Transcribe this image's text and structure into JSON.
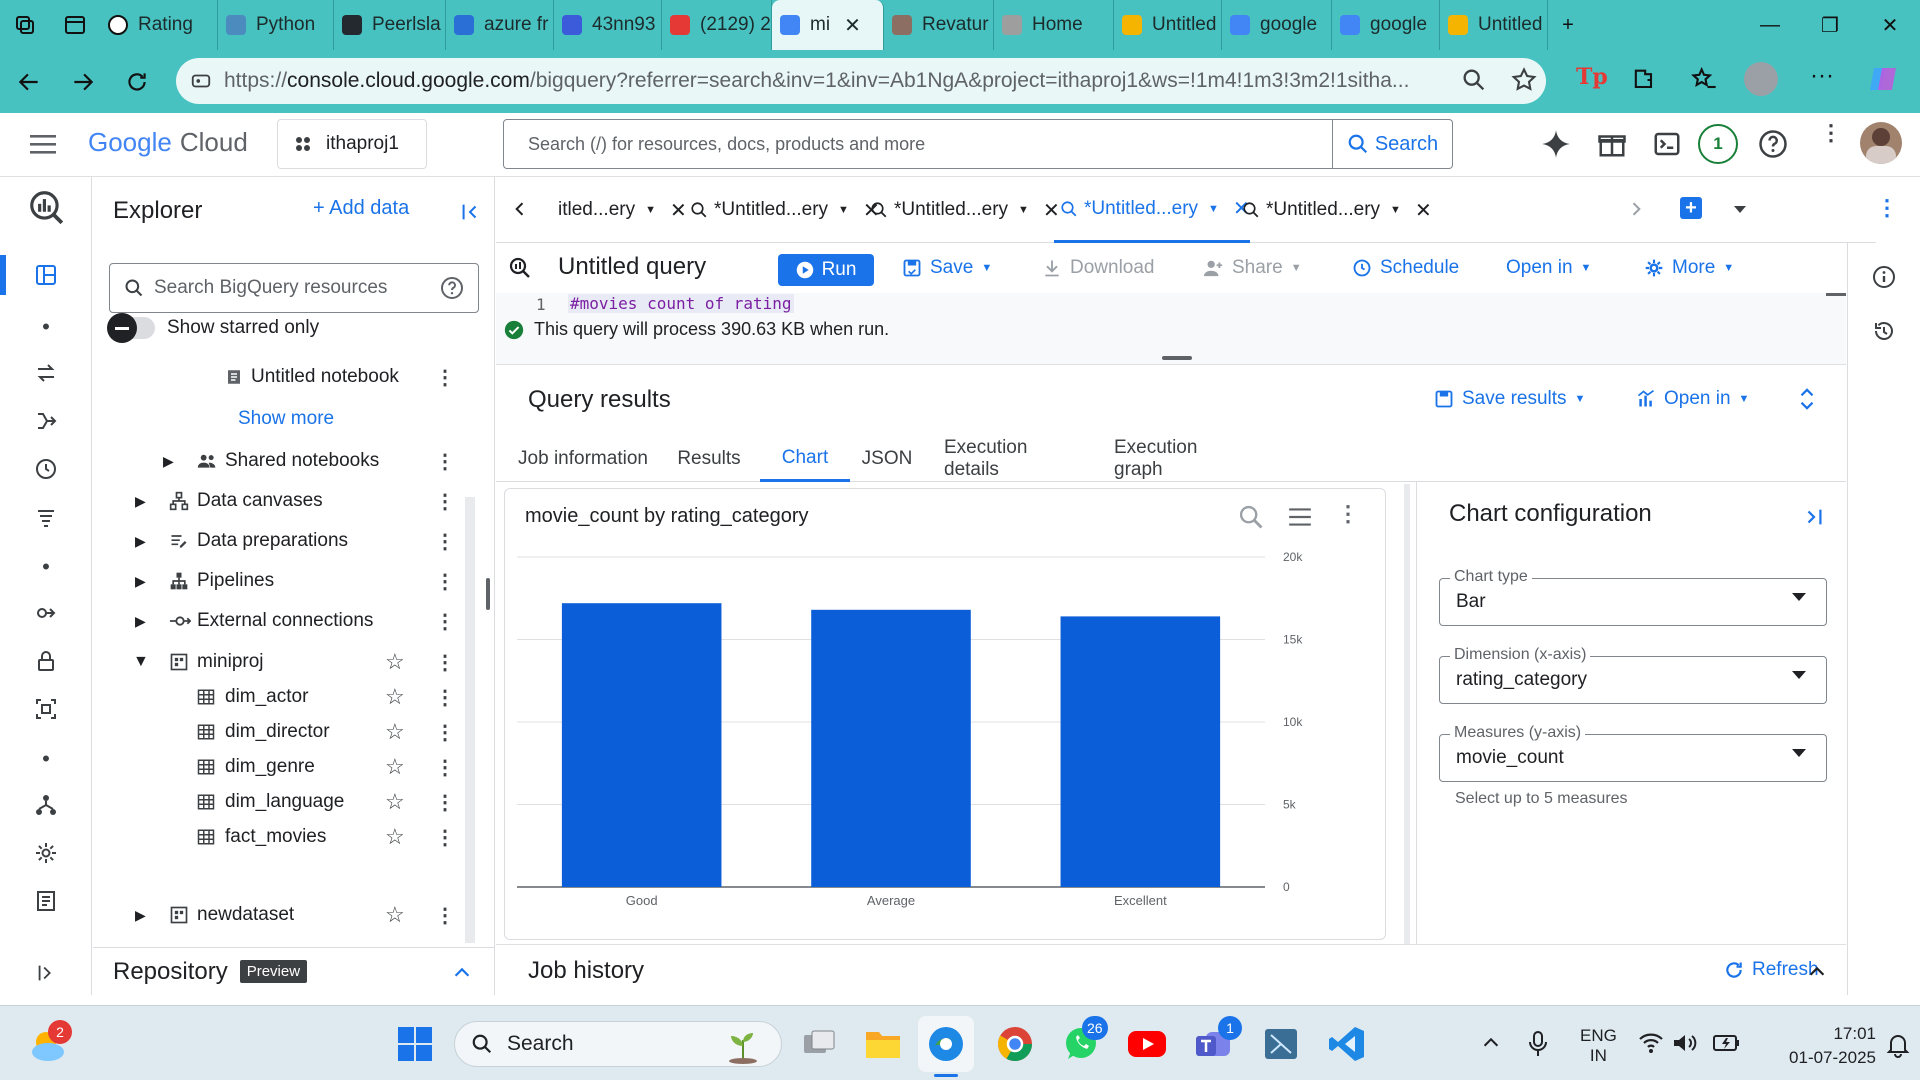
{
  "browser": {
    "tabs": [
      {
        "label": "Rating",
        "color": "#ffffff"
      },
      {
        "label": "Python",
        "color": "#4b8bbe"
      },
      {
        "label": "Peerlsla",
        "color": "#24292f"
      },
      {
        "label": "azure fr",
        "color": "#2a6fd6"
      },
      {
        "label": "43nn93",
        "color": "#3b5bdb"
      },
      {
        "label": "(2129) 2",
        "color": "#e53935"
      },
      {
        "label": "mi",
        "color": "#4285f4"
      },
      {
        "label": "Revatur",
        "color": "#8d6e63"
      },
      {
        "label": "Home",
        "color": "#9e9e9e"
      },
      {
        "label": "Untitled",
        "color": "#f4b400"
      },
      {
        "label": "google",
        "color": "#4285f4"
      },
      {
        "label": "google",
        "color": "#4285f4"
      },
      {
        "label": "Untitled",
        "color": "#f4b400"
      }
    ],
    "url_prefix": "https://",
    "url_host": "console.cloud.google.com",
    "url_rest": "/bigquery?referrer=search&inv=1&inv=Ab1NgA&project=ithaproj1&ws=!1m4!1m3!3m2!1sitha..."
  },
  "gcp": {
    "logo_google": "Google",
    "logo_cloud": "Cloud",
    "project": "ithaproj1",
    "search_placeholder": "Search (/) for resources, docs, products and more",
    "search_button": "Search",
    "notification_count": "1"
  },
  "explorer": {
    "title": "Explorer",
    "add_data": "+ Add data",
    "search_placeholder": "Search BigQuery resources",
    "show_starred": "Show starred only",
    "untitled_notebook": "Untitled notebook",
    "show_more": "Show more",
    "shared_notebooks": "Shared notebooks",
    "data_canvases": "Data canvases",
    "data_preparations": "Data preparations",
    "pipelines": "Pipelines",
    "external_connections": "External connections",
    "dataset": "miniproj",
    "tables": [
      "dim_actor",
      "dim_director",
      "dim_genre",
      "dim_language",
      "fact_movies"
    ],
    "dataset2": "newdataset",
    "repository": "Repository",
    "preview_badge": "Preview"
  },
  "editor_tabs": [
    "itled...ery",
    "*Untitled...ery",
    "*Untitled...ery",
    "*Untitled...ery",
    "*Untitled...ery"
  ],
  "toolbar": {
    "query_title": "Untitled query",
    "run": "Run",
    "save": "Save",
    "download": "Download",
    "share": "Share",
    "schedule": "Schedule",
    "open_in": "Open in",
    "more": "More"
  },
  "editor": {
    "line_number": "1",
    "code": "#movies count of rating",
    "validation": "This query will process 390.63 KB when run."
  },
  "results": {
    "title": "Query results",
    "save_results": "Save results",
    "open_in": "Open in",
    "tabs": [
      "Job information",
      "Results",
      "Chart",
      "JSON",
      "Execution details",
      "Execution graph"
    ]
  },
  "chart_data": {
    "type": "bar",
    "title": "movie_count by rating_category",
    "categories": [
      "Good",
      "Average",
      "Excellent"
    ],
    "values": [
      17200,
      16800,
      16400
    ],
    "ylim": [
      0,
      20000
    ],
    "yticks": [
      "0",
      "5k",
      "10k",
      "15k",
      "20k"
    ],
    "ytick_values": [
      0,
      5000,
      10000,
      15000,
      20000
    ],
    "grid": true,
    "bar_color": "#0b5ed7"
  },
  "chart_config": {
    "title": "Chart configuration",
    "chart_type_label": "Chart type",
    "chart_type_value": "Bar",
    "dimension_label": "Dimension (x-axis)",
    "dimension_value": "rating_category",
    "measures_label": "Measures (y-axis)",
    "measures_value": "movie_count",
    "measures_hint": "Select up to 5 measures"
  },
  "job_history": {
    "title": "Job history",
    "refresh": "Refresh"
  },
  "taskbar": {
    "search": "Search",
    "lang_top": "ENG",
    "lang_bottom": "IN",
    "time": "17:01",
    "date": "01-07-2025",
    "weather_badge": "2",
    "whatsapp_badge": "26",
    "teams_badge": "1"
  }
}
